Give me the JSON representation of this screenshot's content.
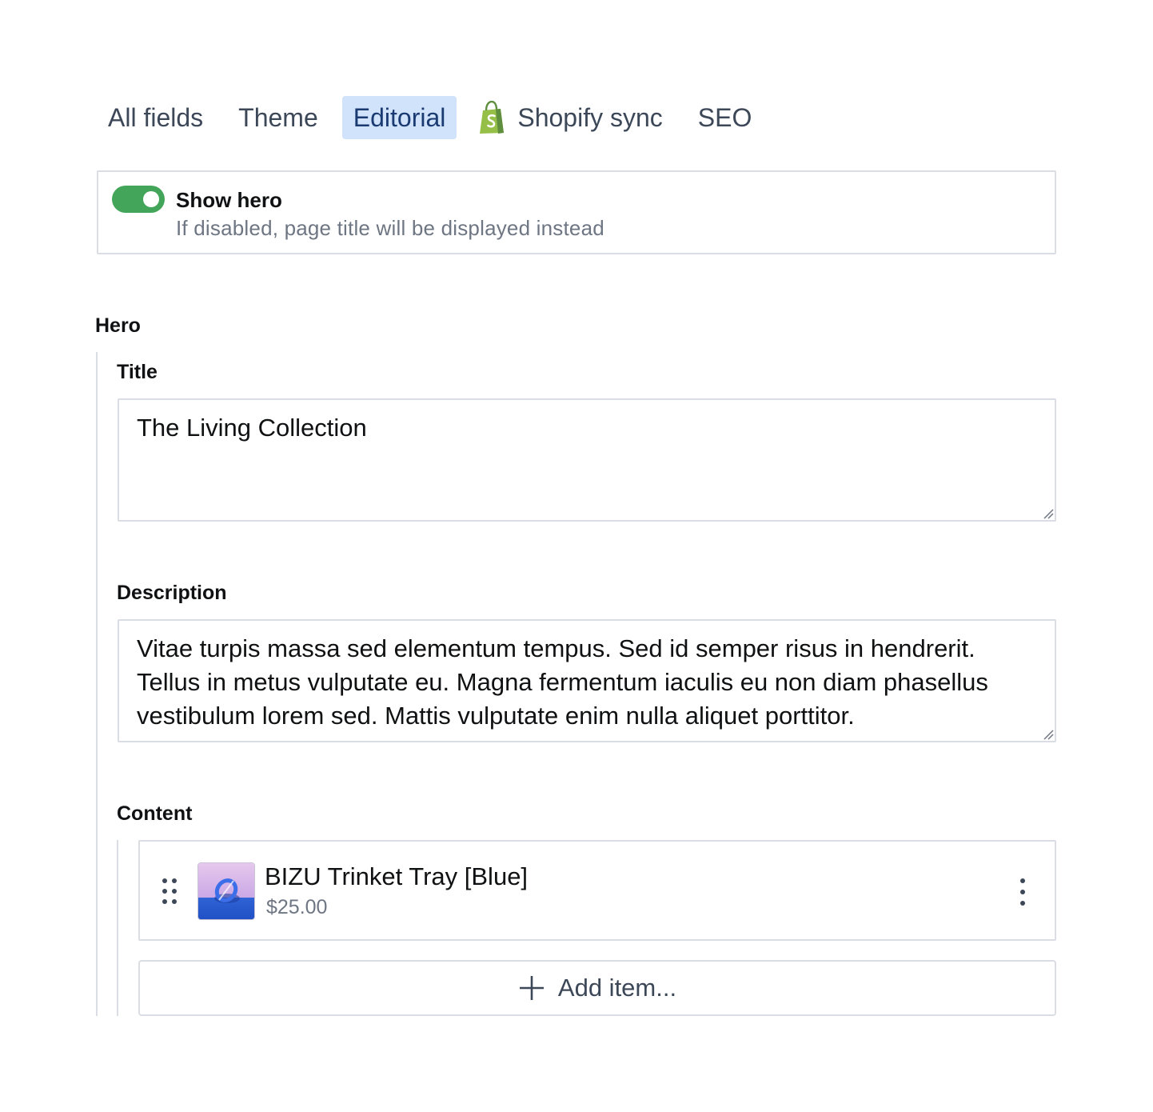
{
  "tabs": [
    {
      "label": "All fields",
      "active": false
    },
    {
      "label": "Theme",
      "active": false
    },
    {
      "label": "Editorial",
      "active": true
    },
    {
      "label": "Shopify sync",
      "active": false,
      "icon": "shopify-bag-icon"
    },
    {
      "label": "SEO",
      "active": false
    }
  ],
  "show_hero": {
    "label": "Show hero",
    "description": "If disabled, page title will be displayed instead",
    "enabled": true
  },
  "hero": {
    "section_label": "Hero",
    "title_label": "Title",
    "title_value": "The Living Collection",
    "description_label": "Description",
    "description_value": "Vitae turpis massa sed elementum tempus. Sed id semper risus in hendrerit. Tellus in metus vulputate eu. Magna fermentum iaculis eu non diam phasellus vestibulum lorem sed. Mattis vulputate enim nulla aliquet porttitor.",
    "content_label": "Content",
    "content_items": [
      {
        "title": "BIZU Trinket Tray [Blue]",
        "price": "$25.00"
      }
    ],
    "add_item_label": "Add item..."
  },
  "colors": {
    "toggle_on": "#43a559",
    "active_tab_bg": "#d1e2fb",
    "active_tab_text": "#1a3b72",
    "border": "#dadde3",
    "muted_text": "#6e7683",
    "shopify_green": "#95bf47"
  }
}
